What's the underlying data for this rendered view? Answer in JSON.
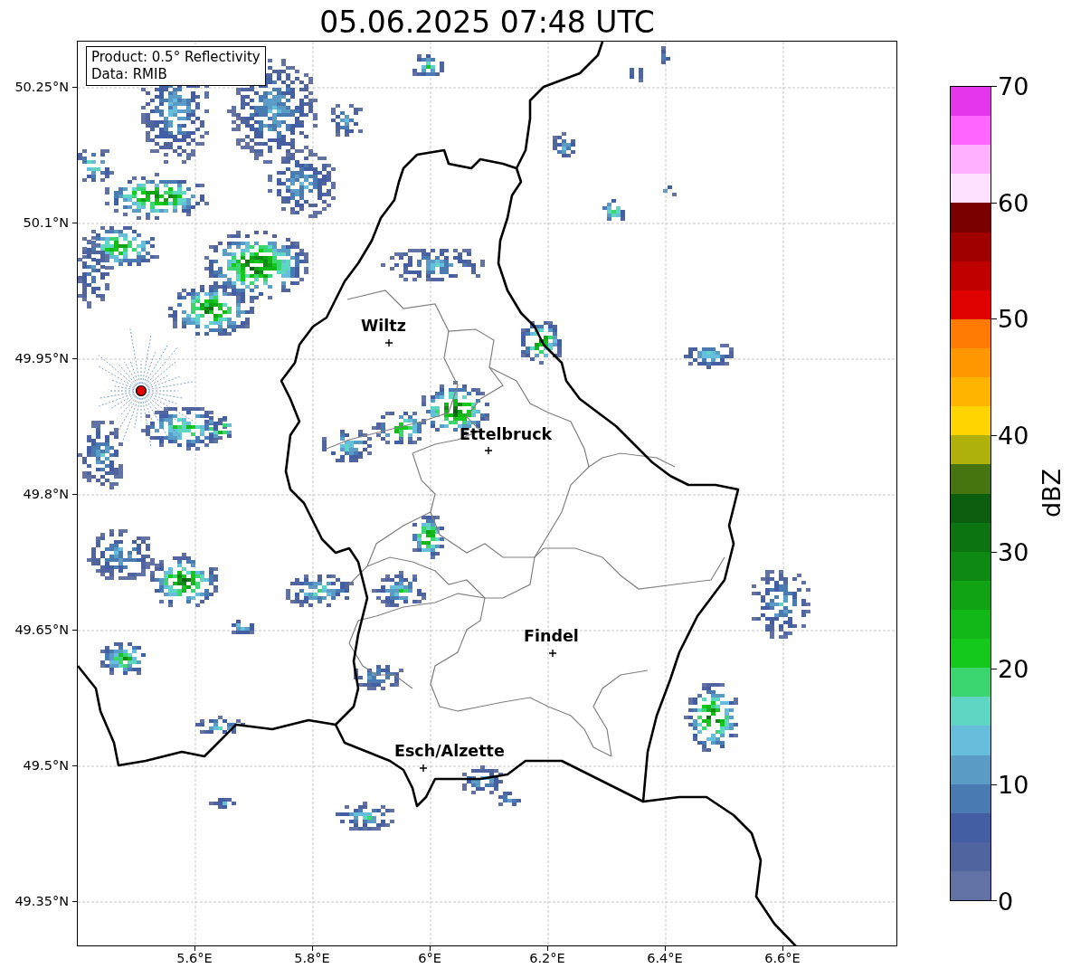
{
  "title": "05.06.2025 07:48 UTC",
  "info_box": {
    "lines": [
      "Product: 0.5° Reflectivity",
      "Data: RMIB"
    ]
  },
  "map": {
    "yticks": [
      "50.25°N",
      "50.1°N",
      "49.95°N",
      "49.8°N",
      "49.65°N",
      "49.5°N",
      "49.35°N"
    ],
    "xticks": [
      "5.6°E",
      "5.8°E",
      "6°E",
      "6.2°E",
      "6.4°E",
      "6.6°E"
    ],
    "cities": [
      {
        "name": "Wiltz"
      },
      {
        "name": "Ettelbruck"
      },
      {
        "name": "Findel"
      },
      {
        "name": "Esch/Alzette"
      }
    ]
  },
  "colorbar": {
    "label": "dBZ",
    "ticks": [
      "70",
      "60",
      "50",
      "40",
      "30",
      "20",
      "10",
      "0"
    ],
    "bins": [
      {
        "color": "#e636ec"
      },
      {
        "color": "#ff66ff"
      },
      {
        "color": "#ffb0ff"
      },
      {
        "color": "#ffe0ff"
      },
      {
        "color": "#780000"
      },
      {
        "color": "#a00000"
      },
      {
        "color": "#c00000"
      },
      {
        "color": "#e00000"
      },
      {
        "color": "#ff7a00"
      },
      {
        "color": "#ff9800"
      },
      {
        "color": "#ffb400"
      },
      {
        "color": "#ffd400"
      },
      {
        "color": "#b0b00a"
      },
      {
        "color": "#467410"
      },
      {
        "color": "#0a5e0e"
      },
      {
        "color": "#0c7410"
      },
      {
        "color": "#0e8a12"
      },
      {
        "color": "#10a414"
      },
      {
        "color": "#12b818"
      },
      {
        "color": "#14c81c"
      },
      {
        "color": "#3cd670"
      },
      {
        "color": "#5fd6c4"
      },
      {
        "color": "#66bedc"
      },
      {
        "color": "#5a9cc6"
      },
      {
        "color": "#4a7ab2"
      },
      {
        "color": "#445ea4"
      },
      {
        "color": "#5064a0"
      },
      {
        "color": "#6272a4"
      }
    ]
  }
}
